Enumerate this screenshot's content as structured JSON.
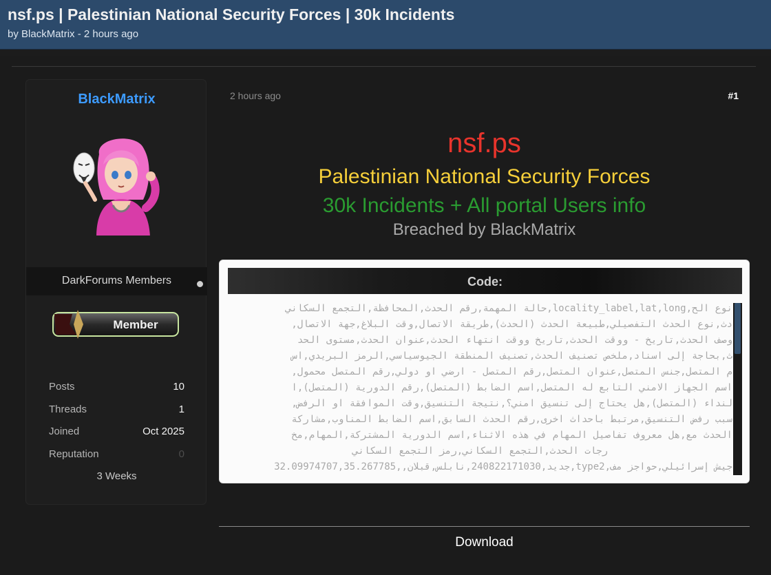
{
  "thread": {
    "title": "nsf.ps | Palestinian National Security Forces | 30k Incidents",
    "by_prefix": "by",
    "author": "BlackMatrix",
    "time_suffix": "- 2 hours ago"
  },
  "user": {
    "name": "BlackMatrix",
    "group": "DarkForums Members",
    "rank_badge": "Member",
    "stats": [
      {
        "label": "Posts",
        "value": "10"
      },
      {
        "label": "Threads",
        "value": "1"
      },
      {
        "label": "Joined",
        "value": "Oct 2025"
      },
      {
        "label": "Reputation",
        "value": "0"
      }
    ],
    "membership": "3 Weeks"
  },
  "post": {
    "date": "2 hours ago",
    "number": "#1",
    "headline": {
      "domain": "nsf.ps",
      "org": "Palestinian National Security Forces",
      "incidents": "30k Incidents + All portal Users info",
      "breach": "Breached by BlackMatrix"
    },
    "code": {
      "label": "Code:",
      "lines": [
        "نوع الح,locality_label,lat,long,حالة المهمة,رقم الحدث,المحافظة,التجمع السكاني",
        "دث,نوع الحدث التفصيلي,طبيعة الحدث (الحدث),طريقة الاتصال,وقت البلاغ,جهة الاتصال,",
        "وصف الحدث,تاريخ - ووقت الحدث,تاريخ ووقت انتهاء الحدث,عنوان الحدث,مستوى الحد",
        "ث,بحاجة إلى اسناد,ملخص تصنيف الحدث,تصنيف المنطقة الجيوسياسي,الرمز البريدي,اس",
        "م المتصل,جنس المتصل,عنوان المتصل,رقم المتصل - ارضي او دولي,رقم المتصل محمول,",
        "اسم الجهاز الامني التابع له المتصل,اسم الضابط (المتصل),رقم الدورية (المتصل),ا",
        "لنداء (المتصل),هل يحتاج إلى تنسيق امني؟,نتيجة التنسيق,وقت الموافقة او الرفض,",
        "سبب رفض التنسيق,مرتبط باحداث اخرى,رقم الحدث السابق,اسم الضابط المناوب,مشاركة",
        "الحدث مع,هل معروف تفاصيل المهام في هذه الاثناء,اسم الدورية المشتركة,المهام,مخ",
        "رجات الحدث,التجمع السكاني,رمز التجمع السكاني",
        "جيش إسرائيلي,حواجز مف,type2,جديد,240822171030,نابلس,قبلان,,32.09974707,35.267785"
      ]
    },
    "download": "Download"
  }
}
